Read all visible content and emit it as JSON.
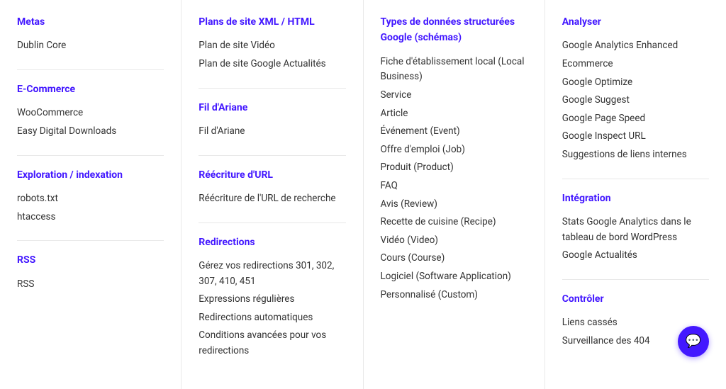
{
  "columns": [
    {
      "id": "col1",
      "sections": [
        {
          "id": "metas",
          "title": "Metas",
          "items": [
            "Dublin Core"
          ]
        },
        {
          "id": "ecommerce",
          "title": "E-Commerce",
          "items": [
            "WooCommerce",
            "Easy Digital Downloads"
          ]
        },
        {
          "id": "exploration",
          "title": "Exploration / indexation",
          "items": [
            "robots.txt",
            "htaccess"
          ]
        },
        {
          "id": "rss",
          "title": "RSS",
          "items": [
            "RSS"
          ]
        }
      ]
    },
    {
      "id": "col2",
      "sections": [
        {
          "id": "plans-site",
          "title": "Plans de site XML / HTML",
          "items": [
            "Plan de site Vidéo",
            "Plan de site Google Actualités"
          ]
        },
        {
          "id": "fil-ariane",
          "title": "Fil d'Ariane",
          "items": [
            "Fil d'Ariane"
          ]
        },
        {
          "id": "reecriture",
          "title": "Réécriture d'URL",
          "items": [
            "Réécriture de l'URL de recherche"
          ]
        },
        {
          "id": "redirections",
          "title": "Redirections",
          "items": [
            "Gérez vos redirections 301, 302, 307, 410, 451",
            "Expressions régulières",
            "Redirections automatiques",
            "Conditions avancées pour vos redirections"
          ]
        }
      ]
    },
    {
      "id": "col3",
      "sections": [
        {
          "id": "types-donnees",
          "title": "Types de données structurées Google (schémas)",
          "items": [
            "Fiche d'établissement local (Local Business)",
            "Service",
            "Article",
            "Événement (Event)",
            "Offre d'emploi (Job)",
            "Produit (Product)",
            "FAQ",
            "Avis (Review)",
            "Recette de cuisine (Recipe)",
            "Vidéo (Video)",
            "Cours (Course)",
            "Logiciel (Software Application)",
            "Personnalisé (Custom)"
          ]
        }
      ]
    },
    {
      "id": "col4",
      "sections": [
        {
          "id": "analyser",
          "title": "Analyser",
          "items": [
            "Google Analytics Enhanced",
            "Ecommerce",
            "Google Optimize",
            "Google Suggest",
            "Google Page Speed",
            "Google Inspect URL",
            "Suggestions de liens internes"
          ]
        },
        {
          "id": "integration",
          "title": "Intégration",
          "items": [
            "Stats Google Analytics dans le tableau de bord WordPress",
            "Google Actualités"
          ]
        },
        {
          "id": "controler",
          "title": "Contrôler",
          "items": [
            "Liens cassés",
            "Surveillance des 404"
          ]
        }
      ]
    }
  ],
  "fab": {
    "icon": "💬"
  }
}
